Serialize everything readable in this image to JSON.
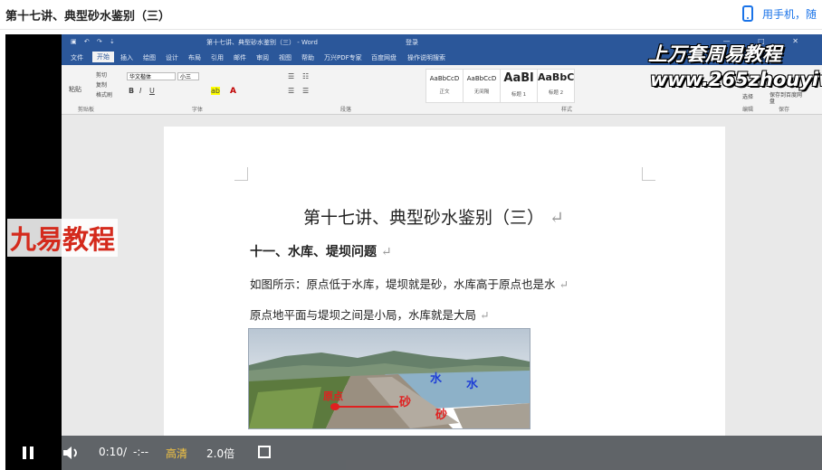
{
  "page": {
    "title": "第十七讲、典型砂水鉴别（三）",
    "phone_link": "用手机，随"
  },
  "word": {
    "window_title": "第十七讲、典型砂水鉴别（三） - Word",
    "login_label": "登录",
    "qat": "▣ ↶ ↷ ⇣",
    "window_controls": "— □ ✕",
    "menu": [
      "文件",
      "开始",
      "插入",
      "绘图",
      "设计",
      "布局",
      "引用",
      "邮件",
      "审阅",
      "视图",
      "帮助",
      "万兴PDF专家",
      "百度网盘",
      "操作说明搜索"
    ],
    "active_menu": "开始",
    "clipboard": {
      "paste": "粘贴",
      "cut": "剪切",
      "copy": "复制",
      "format": "格式刷",
      "group": "剪贴板"
    },
    "font": {
      "name": "华文楷体",
      "size": "小三",
      "group": "字体"
    },
    "paragraph_group": "段落",
    "styles": [
      {
        "preview": "AaBbCcD",
        "name": "正文"
      },
      {
        "preview": "AaBbCcD",
        "name": "无间隔"
      },
      {
        "preview": "AaBl",
        "name": "标题 1"
      },
      {
        "preview": "AaBbC",
        "name": "标题 2"
      }
    ],
    "styles_group": "样式",
    "editing_group": "编辑",
    "save_group": "保存",
    "select_label": "选择",
    "save_to_baidu": "保存到百度网盘"
  },
  "document": {
    "heading": "第十七讲、典型砂水鉴别（三）",
    "subheading": "十一、水库、堤坝问题",
    "para1": "如图所示：原点低于水库，堤坝就是砂，水库高于原点也是水",
    "para2": "原点地平面与堤坝之间是小局，水库就是大局",
    "paragraph_mark": "↵",
    "image_labels": {
      "water1": "水",
      "water2": "水",
      "origin": "原点",
      "sand1": "砂",
      "sand2": "砂"
    }
  },
  "watermarks": {
    "top": "上万套周易教程",
    "url": "www.265zhouyiw.com",
    "left": "九易教程"
  },
  "player": {
    "time": "0:10",
    "separator": "/",
    "duration": "-:--",
    "quality": "高清",
    "speed": "2.0倍"
  },
  "colors": {
    "word_blue": "#2b579a",
    "annotation_red": "#e02020",
    "annotation_blue": "#1f3fd6",
    "watermark_red": "#d42a1c"
  }
}
